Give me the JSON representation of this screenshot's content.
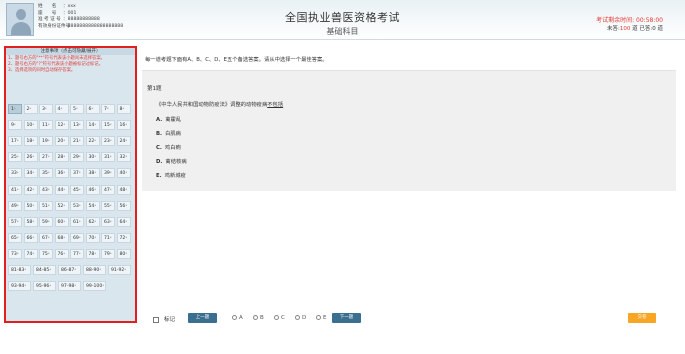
{
  "candidate": {
    "name_label": "姓　　名",
    "name_value": "xxx",
    "seat_label": "座　　号",
    "seat_value": "001",
    "ticket_label": "准 考 证 号",
    "ticket_value": "88888888888",
    "id_label": "有效身份证件号",
    "id_value": "8888888888888888888"
  },
  "header": {
    "title": "全国执业兽医资格考试",
    "subtitle": "基础科目",
    "timer_label": "考试剩余时间:",
    "timer_value": "00:58:00",
    "progress_prefix": "未答:",
    "unanswered": "100",
    "progress_mid": "道 已答:",
    "answered": "0",
    "progress_suffix": "道"
  },
  "notice": {
    "title": "注意事项（点击可隐藏/展开）",
    "lines": [
      "1、题号右方的\"**\"符号代表该小题尚未选择答案。",
      "2、题号右方的\"?\"符号代表该小题被标记过标记。",
      "3、选择选项的同时自动保存答案。"
    ]
  },
  "question_nav": {
    "numbers": [
      "1",
      "2",
      "3",
      "4",
      "5",
      "6",
      "7",
      "8",
      "9",
      "10",
      "11",
      "12",
      "13",
      "14",
      "15",
      "16",
      "17",
      "18",
      "19",
      "20",
      "21",
      "22",
      "23",
      "24",
      "25",
      "26",
      "27",
      "28",
      "29",
      "30",
      "31",
      "32",
      "33",
      "34",
      "35",
      "36",
      "37",
      "38",
      "39",
      "40",
      "41",
      "42",
      "43",
      "44",
      "45",
      "46",
      "47",
      "48",
      "49",
      "50",
      "51",
      "52",
      "53",
      "54",
      "55",
      "56",
      "57",
      "58",
      "59",
      "60",
      "61",
      "62",
      "63",
      "64",
      "65",
      "66",
      "67",
      "68",
      "69",
      "70",
      "71",
      "72",
      "73",
      "74",
      "75",
      "76",
      "77",
      "78",
      "79",
      "80"
    ],
    "marker": "*",
    "groups": [
      "81-83",
      "84-85",
      "86-87",
      "88-90",
      "91-92",
      "93-94",
      "95-96",
      "97-98",
      "99-100"
    ]
  },
  "main": {
    "instruction": "每一道考题下面有A、B、C、D、E五个备选答案。请从中选择一个最佳答案。",
    "question_number": "第1题",
    "stem_prefix": "《中华人民共和国动物防疫法》调整的动物疫病",
    "stem_underlined": "不包括",
    "options": [
      {
        "letter": "A.",
        "text": "禽霍乱"
      },
      {
        "letter": "B.",
        "text": "白肌病"
      },
      {
        "letter": "C.",
        "text": "鸡白痢"
      },
      {
        "letter": "D.",
        "text": "禽结核病"
      },
      {
        "letter": "E.",
        "text": "鸡新城疫"
      }
    ]
  },
  "bottom": {
    "mark_label": "标记",
    "prev_label": "上一题",
    "next_label": "下一题",
    "radio_options": [
      "A",
      "B",
      "C",
      "D",
      "E"
    ],
    "submit_label": "交卷"
  },
  "colors": {
    "accent": "#3b6f90",
    "highlight": "#e21f1f",
    "submit": "#f6a623",
    "timer": "#e53935"
  }
}
